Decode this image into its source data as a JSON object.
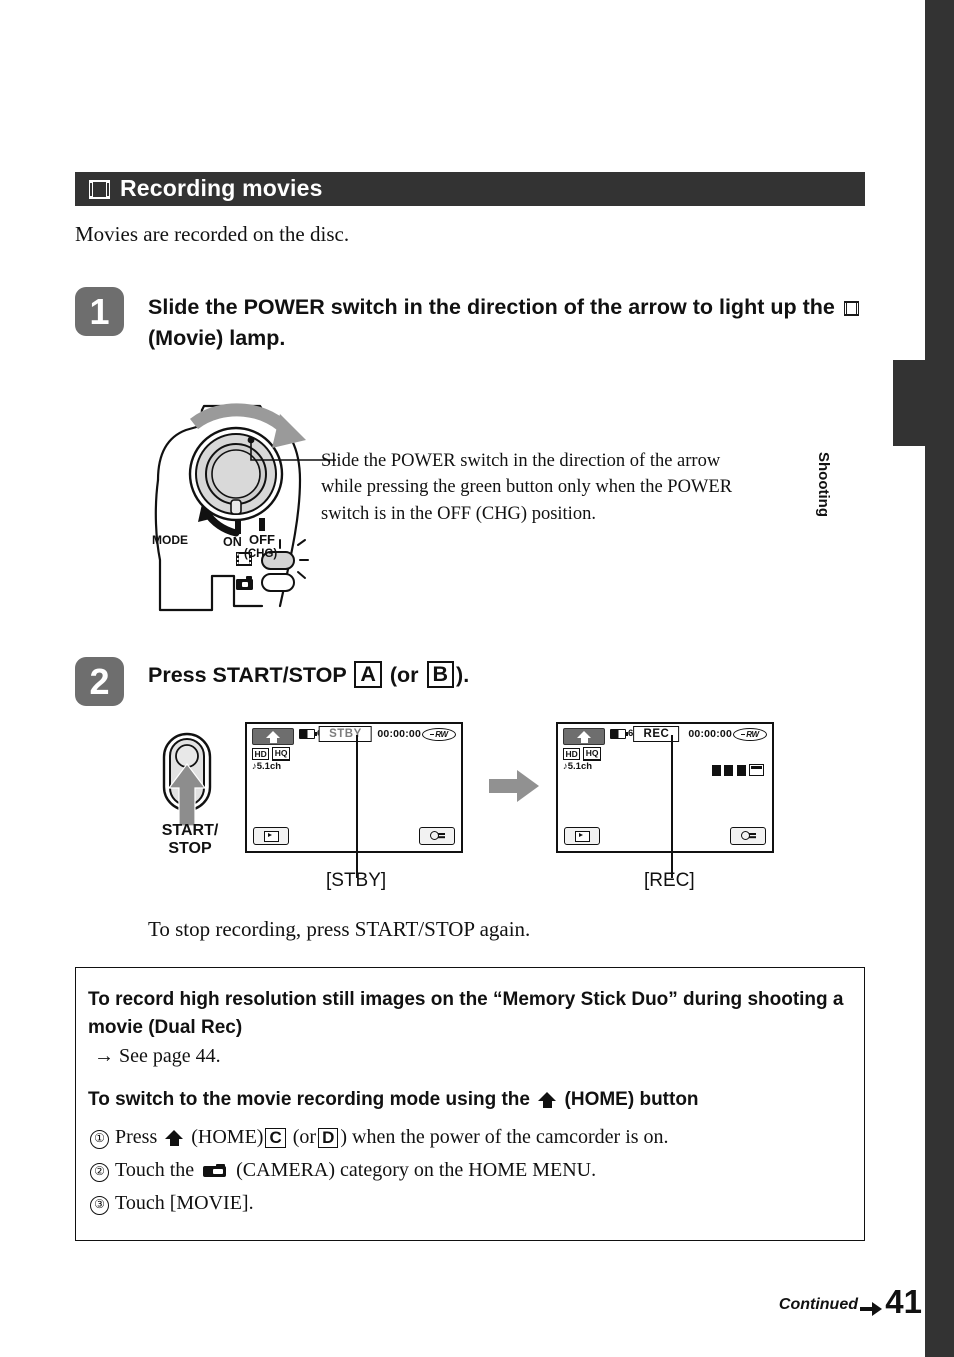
{
  "page": {
    "number": "41",
    "continued_label": "Continued",
    "side_tab": "Shooting"
  },
  "section": {
    "icon": "film-strip-icon",
    "title": "Recording movies",
    "intro": "Movies are recorded on the disc."
  },
  "steps": [
    {
      "number": "1",
      "text_before_icon": "Slide the POWER switch in the direction of the arrow to light up the",
      "icon": "film-strip-icon",
      "text_after_icon": "(Movie) lamp."
    },
    {
      "number": "2",
      "text_before": "Press START/STOP",
      "badge_a": "A",
      "text_middle": "(or",
      "badge_b": "B",
      "text_after": ")."
    }
  ],
  "illustration": {
    "camcorder_labels": {
      "mode": "MODE",
      "on": "ON",
      "off": "OFF",
      "chg": "(CHG)"
    },
    "callout": "Slide the POWER switch in the direction of the arrow while pressing the green button only when the POWER switch is in the OFF (CHG) position.",
    "start_stop_button": "START/\nSTOP",
    "start_stop_line1": "START/",
    "start_stop_line2": "STOP"
  },
  "lcd_screens": {
    "stby": {
      "home_icon": "home-icon",
      "battery": "60min",
      "mode_badge": "STBY",
      "timecode": "00:00:00",
      "disc_format": "RW",
      "quality_tags": [
        "HD",
        "HQ"
      ],
      "audio": "5.1ch",
      "playback_button": "view-images-icon",
      "options_button": "options-icon",
      "caption": "[STBY]"
    },
    "rec": {
      "home_icon": "home-icon",
      "battery": "60min",
      "mode_badge": "REC",
      "timecode": "00:00:00",
      "disc_format": "RW",
      "quality_tags": [
        "HD",
        "HQ"
      ],
      "audio": "5.1ch",
      "rec_indicator": "recording-bars",
      "playback_button": "view-images-icon",
      "options_button": "options-icon",
      "caption": "[REC]"
    }
  },
  "stop_note": "To stop recording, press START/STOP again.",
  "info_box": {
    "heading1_line1": "To record high resolution still images on the “Memory Stick Duo” during",
    "heading1_line2": "shooting a movie (Dual Rec)",
    "see_page": "→ See page 44.",
    "heading2_before_icon": "To switch to the movie recording mode using the",
    "heading2_icon": "home-icon",
    "heading2_after_icon": "(HOME) button",
    "items": [
      {
        "num": "①",
        "part1": "Press",
        "icon": "home-icon",
        "part2": "(HOME)",
        "badge_c": "C",
        "part3": "(or",
        "badge_d": "D",
        "part4": ") when the power of the camcorder is on."
      },
      {
        "num": "②",
        "part1": "Touch the",
        "icon": "camera-icon",
        "part2": "(CAMERA) category on the HOME MENU."
      },
      {
        "num": "③",
        "part1": "Touch [MOVIE]."
      }
    ]
  },
  "colors": {
    "header_bg": "#333333",
    "step_badge": "#6e6e6e",
    "arrow_grey": "#919191"
  }
}
